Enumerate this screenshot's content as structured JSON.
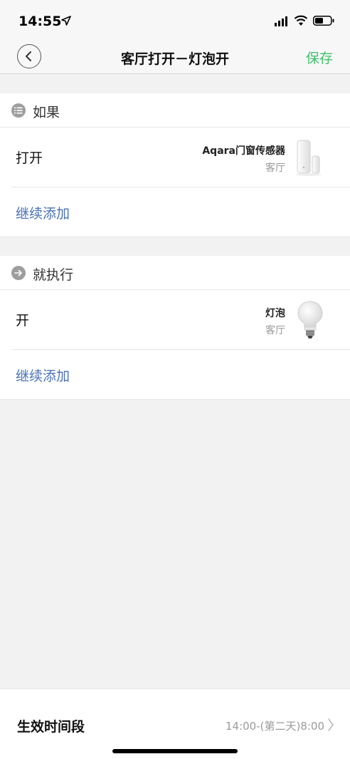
{
  "status_bar": {
    "time": "14:55",
    "icons": [
      "location-arrow-icon",
      "signal-icon",
      "wifi-icon",
      "battery-icon"
    ]
  },
  "nav": {
    "title": "客厅打开－灯泡开",
    "save_label": "保存",
    "back_icon": "chevron-left-icon"
  },
  "if_section": {
    "header_label": "如果",
    "header_icon": "list-icon",
    "rows": [
      {
        "action": "打开",
        "device_name": "Aqara门窗传感器",
        "room": "客厅",
        "device_icon": "door-window-sensor-icon"
      }
    ],
    "add_label": "继续添加"
  },
  "then_section": {
    "header_label": "就执行",
    "header_icon": "arrow-right-icon",
    "rows": [
      {
        "action": "开",
        "device_name": "灯泡",
        "room": "客厅",
        "device_icon": "light-bulb-icon"
      }
    ],
    "add_label": "继续添加"
  },
  "footer": {
    "effective_label": "生效时间段",
    "effective_value": "14:00-(第二天)8:00"
  },
  "colors": {
    "accent_green": "#3fc06b",
    "link_blue": "#4a72b8",
    "background": "#f2f2f2",
    "secondary_text": "#999999"
  }
}
